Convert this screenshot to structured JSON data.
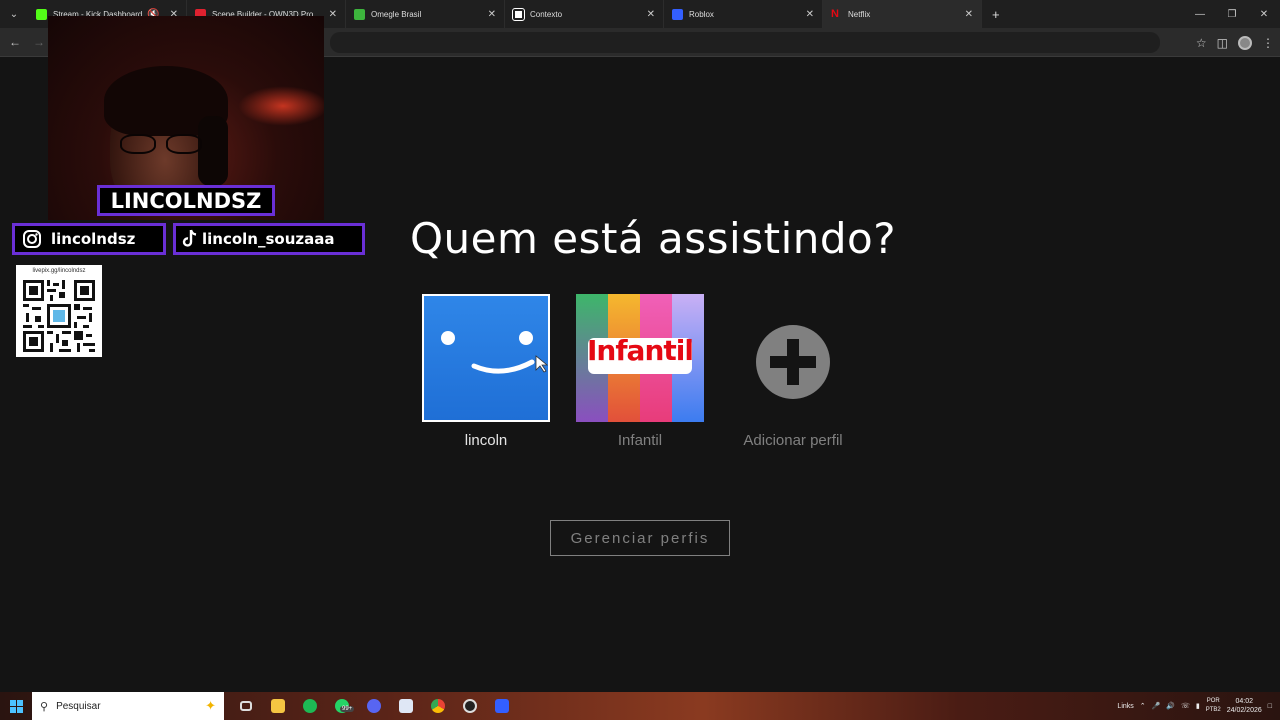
{
  "browser": {
    "tabs": [
      {
        "label": "Stream - Kick Dashboard",
        "icon": "kick-icon",
        "color": "#53fc18",
        "muted": true
      },
      {
        "label": "Scene Builder - OWN3D Pro",
        "icon": "own3d-icon",
        "color": "#e0212f"
      },
      {
        "label": "Omegle Brasil",
        "icon": "omegle-icon",
        "color": "#3db43d"
      },
      {
        "label": "Contexto",
        "icon": "contexto-icon",
        "color": "#ffffff"
      },
      {
        "label": "Roblox",
        "icon": "roblox-icon",
        "color": "#335fff"
      },
      {
        "label": "Netflix",
        "icon": "netflix-icon",
        "color": "#e50914",
        "active": true
      }
    ],
    "new_tab_symbol": "+"
  },
  "netflix": {
    "heading": "Quem está assistindo?",
    "profiles": [
      {
        "name": "lincoln",
        "avatar": "smile-avatar",
        "color": "#2a7fe0"
      },
      {
        "name": "Infantil",
        "avatar": "kids-avatar",
        "badge_text": "Infantil",
        "color": "#e50914"
      },
      {
        "name": "Adicionar perfil",
        "avatar": "add-profile-icon",
        "color": "#808080"
      }
    ],
    "manage_button": "Gerenciar perfis"
  },
  "overlay": {
    "channel_name": "LINCOLNDSZ",
    "instagram": "lincolndsz",
    "tiktok": "lincoln_souzaaa",
    "qr_url": "livepix.gg/lincolndsz",
    "accent_color": "#6a2fd6"
  },
  "taskbar": {
    "search_placeholder": "Pesquisar",
    "notification_badge": "99+",
    "tray_links": "Links",
    "lang_top": "POR",
    "lang_bottom": "PTB2",
    "time": "04:02",
    "date": "24/02/2026"
  }
}
